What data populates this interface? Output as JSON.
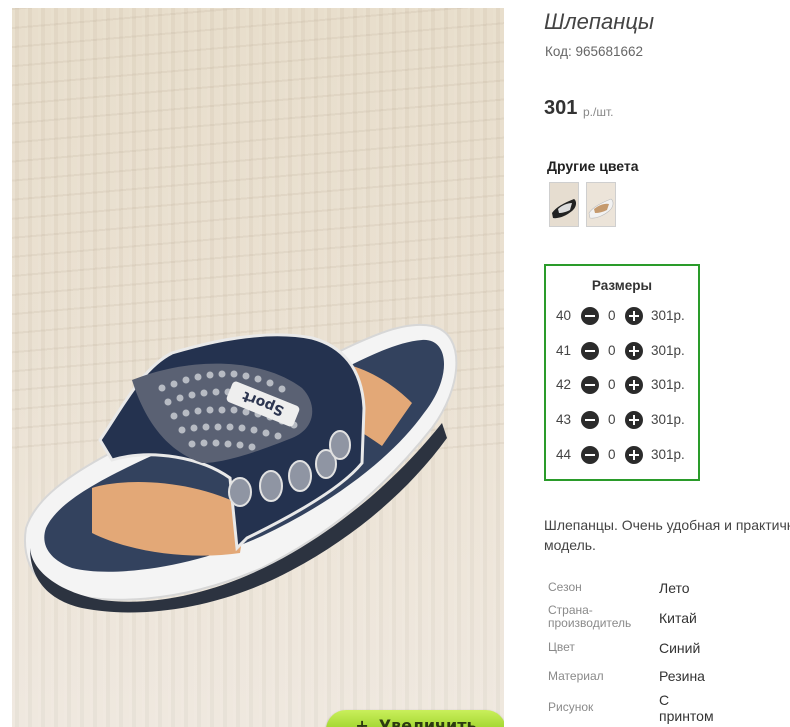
{
  "product": {
    "title": "Шлепанцы",
    "code": "Код: 965681662",
    "price": "301",
    "price_unit": "р./шт."
  },
  "gallery": {
    "zoom_label": "Увеличить",
    "zoom_icon": "plus-icon",
    "print_text": "Sport"
  },
  "other_colors": {
    "title": "Другие цвета",
    "swatches": [
      "black-white sandal",
      "beige sandal"
    ]
  },
  "sizes": {
    "title": "Размеры",
    "rows": [
      {
        "size": "40",
        "qty": "0",
        "price": "301р."
      },
      {
        "size": "41",
        "qty": "0",
        "price": "301р."
      },
      {
        "size": "42",
        "qty": "0",
        "price": "301р."
      },
      {
        "size": "43",
        "qty": "0",
        "price": "301р."
      },
      {
        "size": "44",
        "qty": "0",
        "price": "301р."
      }
    ],
    "accent_color": "#2a9b2a"
  },
  "description": {
    "line1": "Шлепанцы. Очень удобная и практичная",
    "line2": "модель."
  },
  "specs": [
    {
      "label": "Сезон",
      "value": "Лето"
    },
    {
      "label": "Страна-производитель",
      "label_l1": "Страна-",
      "label_l2": "производитель",
      "value": "Китай"
    },
    {
      "label": "Цвет",
      "value": "Синий"
    },
    {
      "label": "Материал",
      "value": "Резина"
    },
    {
      "label": "Рисунок",
      "value": "С принтом",
      "value_l1": "С",
      "value_l2": "принтом"
    }
  ]
}
